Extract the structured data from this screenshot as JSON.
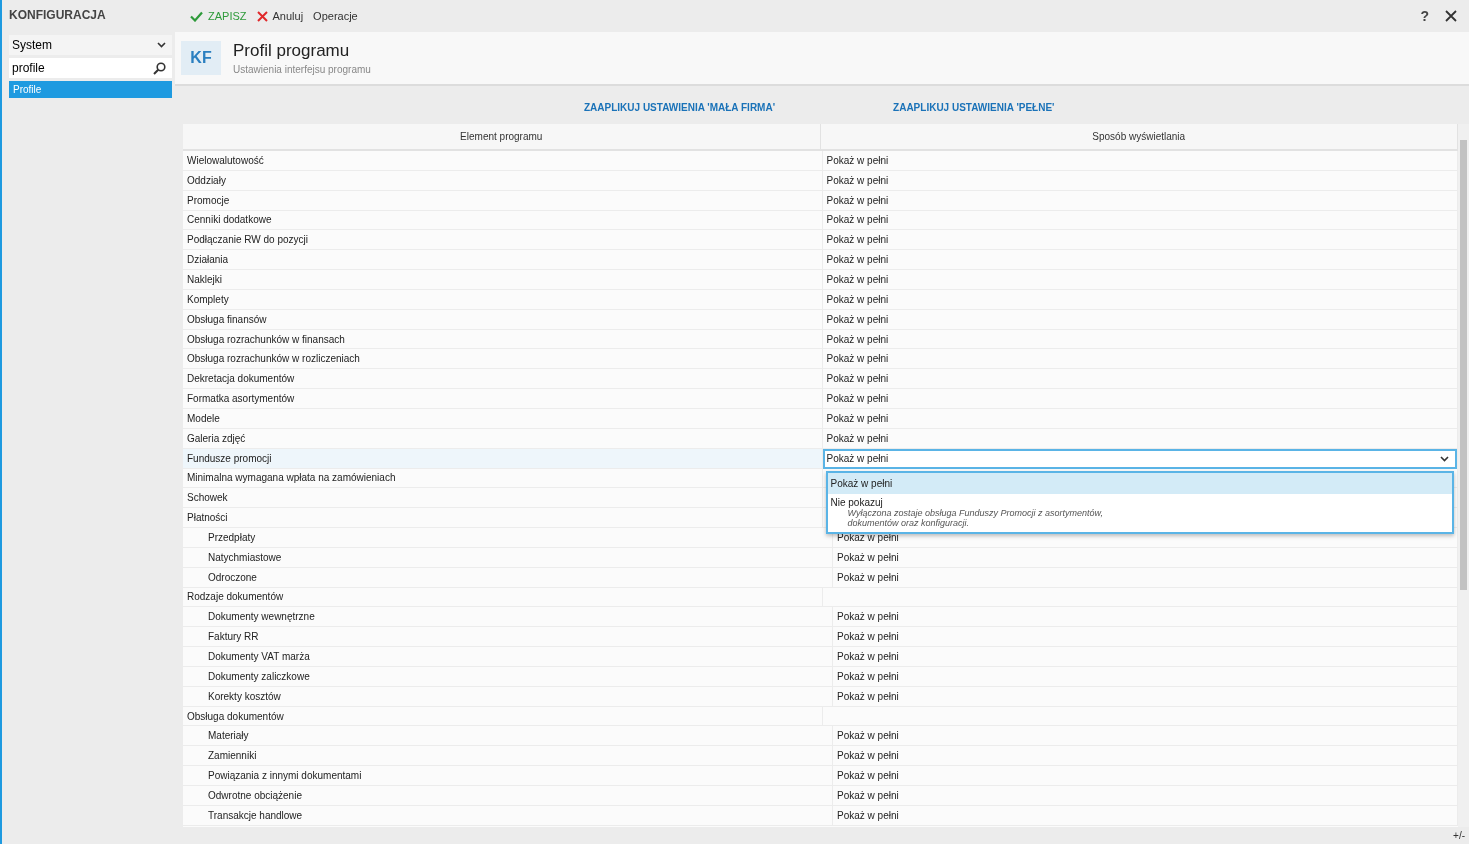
{
  "toolbar": {
    "title": "KONFIGURACJA",
    "buttons": [
      {
        "kind": "save",
        "label": "ZAPISZ"
      },
      {
        "kind": "cancel",
        "label": "Anuluj"
      },
      {
        "kind": "plain",
        "label": "Operacje"
      }
    ],
    "help": "?"
  },
  "sidebar": {
    "category": "System",
    "search": {
      "value": "profile"
    },
    "items": [
      {
        "label": "Profile",
        "selected": true
      }
    ]
  },
  "header": {
    "badge": "KF",
    "title": "Profil programu",
    "subtitle": "Ustawienia interfejsu programu"
  },
  "apply_buttons": [
    "ZAAPLIKUJ USTAWIENIA 'MAŁA FIRMA'",
    "ZAAPLIKUJ USTAWIENIA 'PEŁNE'"
  ],
  "table": {
    "columns": [
      "Element programu",
      "Sposób wyświetlania"
    ],
    "rows": [
      {
        "label": "Wielowalutowość",
        "value": "Pokaż w pełni",
        "selected": false
      },
      {
        "label": "Oddziały",
        "value": "Pokaż w pełni",
        "selected": false
      },
      {
        "label": "Promocje",
        "value": "Pokaż w pełni",
        "selected": false
      },
      {
        "label": "Cenniki dodatkowe",
        "value": "Pokaż w pełni",
        "selected": false
      },
      {
        "label": "Podłączanie RW do pozycji",
        "value": "Pokaż w pełni",
        "selected": false
      },
      {
        "label": "Działania",
        "value": "Pokaż w pełni",
        "selected": false
      },
      {
        "label": "Naklejki",
        "value": "Pokaż w pełni",
        "selected": false
      },
      {
        "label": "Komplety",
        "value": "Pokaż w pełni",
        "selected": false
      },
      {
        "label": "Obsługa finansów",
        "value": "Pokaż w pełni",
        "selected": false
      },
      {
        "label": "Obsługa rozrachunków w finansach",
        "value": "Pokaż w pełni",
        "selected": false
      },
      {
        "label": "Obsługa rozrachunków w rozliczeniach",
        "value": "Pokaż w pełni",
        "selected": false
      },
      {
        "label": "Dekretacja dokumentów",
        "value": "Pokaż w pełni",
        "selected": false
      },
      {
        "label": "Formatka asortymentów",
        "value": "Pokaż w pełni",
        "selected": false
      },
      {
        "label": "Modele",
        "value": "Pokaż w pełni",
        "selected": false
      },
      {
        "label": "Galeria zdjęć",
        "value": "Pokaż w pełni",
        "selected": false
      },
      {
        "label": "Fundusze promocji",
        "value": "Pokaż w pełni",
        "selected": true,
        "dropdown": {
          "expanded": true,
          "options": [
            {
              "label": "Pokaż w pełni",
              "selected": true
            },
            {
              "label": "Nie pokazuj",
              "description": "Wyłączona zostaje obsługa Funduszy Promocji z asortymentów, dokumentów oraz konfiguracji.",
              "selected": false
            }
          ]
        }
      },
      {
        "label": "Minimalna wymagana wpłata na zamówieniach",
        "selected": false
      },
      {
        "label": "Schowek",
        "selected": false
      },
      {
        "label": "Płatności",
        "selected": false,
        "children": [
          {
            "label": "Przedpłaty",
            "value": "Pokaż w pełni",
            "selected": false
          },
          {
            "label": "Natychmiastowe",
            "value": "Pokaż w pełni",
            "selected": false
          },
          {
            "label": "Odroczone",
            "value": "Pokaż w pełni",
            "selected": false
          }
        ]
      },
      {
        "label": "Rodzaje dokumentów",
        "selected": false,
        "children": [
          {
            "label": "Dokumenty wewnętrzne",
            "value": "Pokaż w pełni",
            "selected": false
          },
          {
            "label": "Faktury RR",
            "value": "Pokaż w pełni",
            "selected": false
          },
          {
            "label": "Dokumenty VAT marża",
            "value": "Pokaż w pełni",
            "selected": false
          },
          {
            "label": "Dokumenty zaliczkowe",
            "value": "Pokaż w pełni",
            "selected": false
          },
          {
            "label": "Korekty kosztów",
            "value": "Pokaż w pełni",
            "selected": false
          }
        ]
      },
      {
        "label": "Obsługa dokumentów",
        "selected": false,
        "children": [
          {
            "label": "Materiały",
            "value": "Pokaż w pełni",
            "selected": false
          },
          {
            "label": "Zamienniki",
            "value": "Pokaż w pełni",
            "selected": false
          },
          {
            "label": "Powiązania z innymi dokumentami",
            "value": "Pokaż w pełni",
            "selected": false
          },
          {
            "label": "Odwrotne obciążenie",
            "value": "Pokaż w pełni",
            "selected": false
          },
          {
            "label": "Transakcje handlowe",
            "value": "Pokaż w pełni",
            "selected": false
          }
        ]
      }
    ]
  },
  "footer": "+/-"
}
